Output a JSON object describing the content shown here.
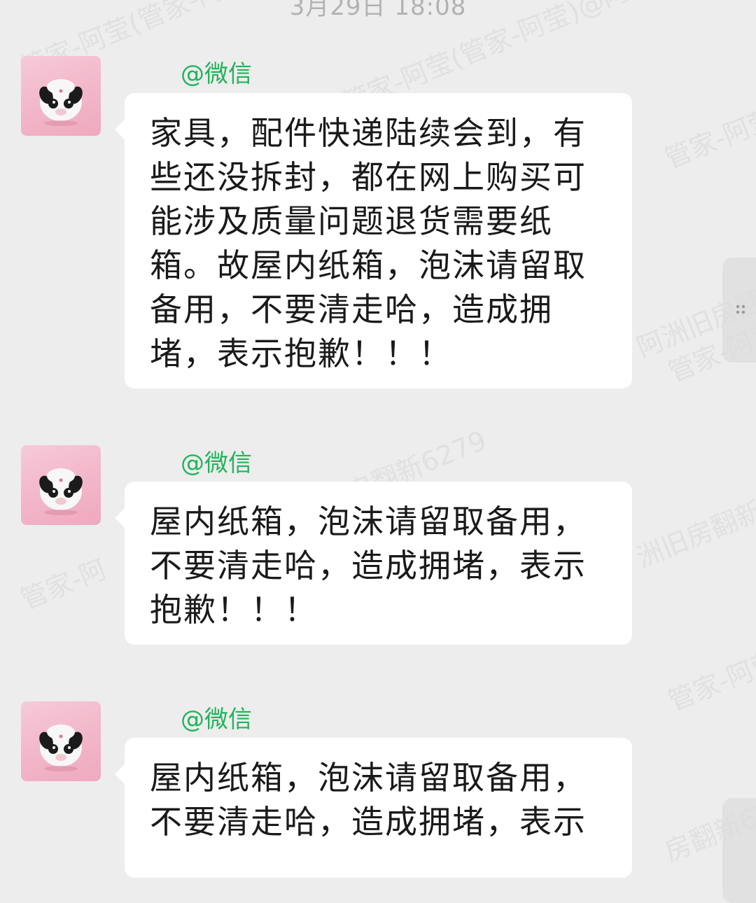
{
  "chat": {
    "timestamp": "3月29日 18:08",
    "watermarks": [
      "管家-阿莹(管家-阿莹)@阿",
      "管家-阿莹(管家-阿莹)@阿",
      "管家-阿莹",
      "阿洲旧房翻新6279",
      "管家-阿",
      "阿洲旧房翻新6279",
      "洲旧房翻新62",
      "管家-阿莹",
      "管家-阿莹",
      "房翻新62"
    ],
    "messages": [
      {
        "sender": "@微信",
        "text": "家具，配件快递陆续会到，有些还没拆封，都在网上购买可能涉及质量问题退货需要纸箱。故屋内纸箱，泡沫请留取备用，不要清走哈，造成拥堵，表示抱歉！！！"
      },
      {
        "sender": "@微信",
        "text": "屋内纸箱，泡沫请留取备用，不要清走哈，造成拥堵，表示抱歉！！！"
      },
      {
        "sender": "@微信",
        "text": "屋内纸箱，泡沫请留取备用，不要清走哈，造成拥堵，表示"
      }
    ]
  },
  "colors": {
    "background": "#ededed",
    "bubble": "#ffffff",
    "sender_name": "#21b35a",
    "text": "#1a1a1a",
    "timestamp": "#b2b2b2"
  },
  "icons": {
    "avatar": "cow-plush-avatar",
    "side_handle": "drag-handle-icon"
  }
}
